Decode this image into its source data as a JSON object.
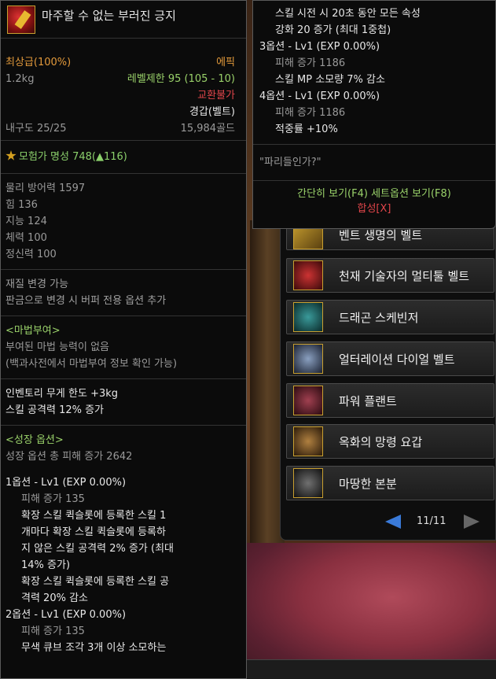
{
  "tooltip": {
    "item_name": "마주할 수 없는 부러진 긍지",
    "grade": "최상급(100%)",
    "rarity": "에픽",
    "weight": "1.2kg",
    "level_limit": "레벨제한 95 (105 - 10)",
    "trade": "교환불가",
    "type": "경갑(벨트)",
    "durability": "내구도 25/25",
    "price": "15,984골드",
    "fame": "모험가 명성 748(▲116)",
    "stats": [
      "물리 방어력 1597",
      "힘 136",
      "지능 124",
      "체력 100",
      "정신력 100"
    ],
    "material": [
      "재질 변경 가능",
      "판금으로 변경 시 버퍼 전용 옵션 추가"
    ],
    "enchant": [
      "<마법부여>",
      "부여된 마법 능력이 없음",
      "(백과사전에서 마법부여 정보 확인 가능)"
    ],
    "effects": [
      "인벤토리 무게 한도 +3kg",
      "스킬 공격력 12% 증가"
    ],
    "growth_header": "<성장 옵션>",
    "growth_total": "성장 옵션 총 피해 증가 2642",
    "opt1": {
      "title": "1옵션 - Lv1 (EXP 0.00%)",
      "dmg": "피해 증가 135",
      "lines": [
        "확장 스킬 퀵슬롯에 등록한 스킬 1",
        "개마다 확장 스킬 퀵슬롯에 등록하",
        "지 않은 스킬 공격력 2% 증가 (최대",
        "14% 증가)",
        "확장 스킬 퀵슬롯에 등록한 스킬 공",
        "격력 20% 감소"
      ]
    },
    "opt2": {
      "title": "2옵션 - Lv1 (EXP 0.00%)",
      "dmg": "피해 증가 135",
      "lines": [
        "무색 큐브 조각 3개 이상 소모하는"
      ]
    }
  },
  "tooltip2": {
    "lines_top": [
      "스킬 시전 시 20초 동안 모든 속성",
      "강화 20 증가 (최대 1중첩)"
    ],
    "opt3": {
      "title": "3옵션 - Lv1 (EXP 0.00%)",
      "dmg": "피해 증가 1186",
      "line": "스킬 MP 소모량 7% 감소"
    },
    "opt4": {
      "title": "4옵션 - Lv1 (EXP 0.00%)",
      "dmg": "피해 증가 1186",
      "line": "적중률 +10%"
    },
    "quote": "\"파리들인가?\"",
    "buttons": "간단히 보기(F4) 세트옵션 보기(F8)",
    "synth": "합성[X]"
  },
  "list": {
    "items": [
      "벤트 생명의 벨트",
      "천재 기술자의 멀티툴 벨트",
      "드래곤 스케빈저",
      "얼터레이션 다이얼 벨트",
      "파워 플랜트",
      "옥화의 망령 요갑",
      "마땅한 본분"
    ],
    "page": "11/11"
  },
  "colors": {
    "epic": "#e39a3b",
    "green": "#9ad26a",
    "red": "#e0454a"
  }
}
